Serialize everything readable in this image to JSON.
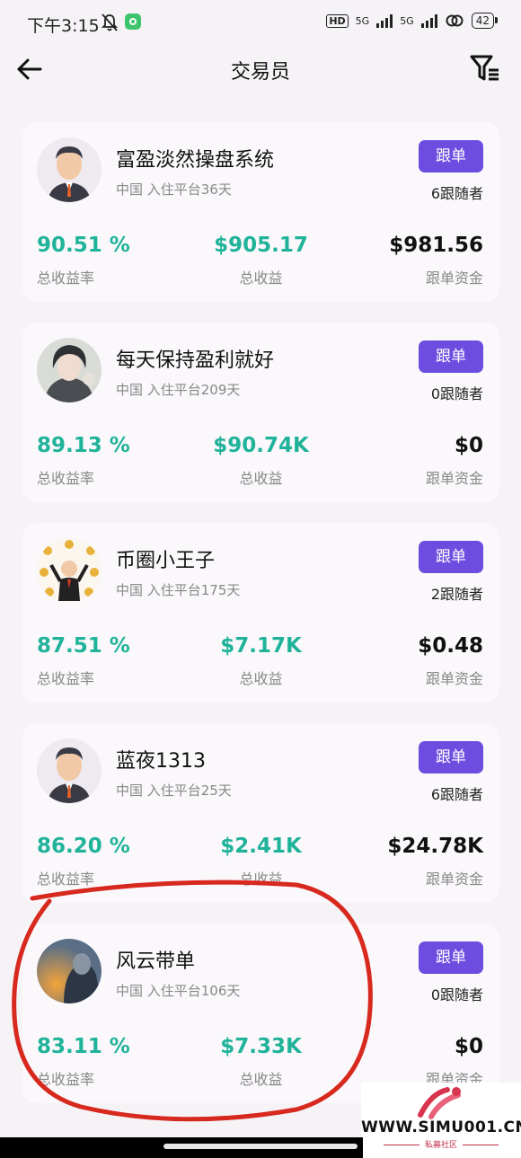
{
  "status": {
    "time": "下午3:15",
    "hd": "HD",
    "net1": "5G",
    "net2": "5G",
    "battery": "42"
  },
  "header": {
    "title": "交易员"
  },
  "follow_label": "跟单",
  "traders": [
    {
      "name": "富盈淡然操盘系统",
      "meta": "中国 入住平台36天",
      "followers": "6跟随者",
      "rate": "90.51 %",
      "profit": "$905.17",
      "funds": "$981.56",
      "avatar": "man-avatar-icon"
    },
    {
      "name": "每天保持盈利就好",
      "meta": "中国 入住平台209天",
      "followers": "0跟随者",
      "rate": "89.13 %",
      "profit": "$90.74K",
      "funds": "$0",
      "avatar": "anime-avatar-icon"
    },
    {
      "name": "币圈小王子",
      "meta": "中国 入住平台175天",
      "followers": "2跟随者",
      "rate": "87.51 %",
      "profit": "$7.17K",
      "funds": "$0.48",
      "avatar": "coins-avatar-icon"
    },
    {
      "name": "蓝夜1313",
      "meta": "中国 入住平台25天",
      "followers": "6跟随者",
      "rate": "86.20 %",
      "profit": "$2.41K",
      "funds": "$24.78K",
      "avatar": "man-avatar-icon"
    },
    {
      "name": "风云带单",
      "meta": "中国 入住平台106天",
      "followers": "0跟随者",
      "rate": "83.11 %",
      "profit": "$7.33K",
      "funds": "$0",
      "avatar": "warrior-avatar-icon"
    }
  ],
  "labels": {
    "rate": "总收益率",
    "profit": "总收益",
    "funds": "跟单资金"
  },
  "watermark": {
    "site": "WWW.SIMU001.CN",
    "sub": "私募社区"
  },
  "colors": {
    "accent": "#6c4de0",
    "green": "#20b39a",
    "annotation": "#d8291f"
  }
}
